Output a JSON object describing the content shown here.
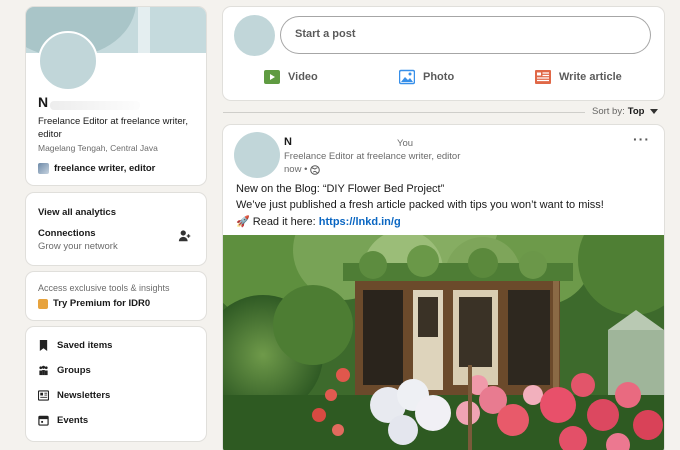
{
  "profile": {
    "name": "N",
    "headline": "Freelance Editor at freelance writer, editor",
    "location": "Magelang Tengah, Central Java",
    "company": "freelance writer, editor"
  },
  "analytics": {
    "view_all": "View all analytics",
    "connections_label": "Connections",
    "connections_sub": "Grow your network"
  },
  "premium": {
    "text": "Access exclusive tools & insights",
    "link": "Try Premium for IDR0"
  },
  "shortcuts": {
    "items": [
      {
        "label": "Saved items",
        "icon": "bookmark-icon"
      },
      {
        "label": "Groups",
        "icon": "groups-icon"
      },
      {
        "label": "Newsletters",
        "icon": "newsletter-icon"
      },
      {
        "label": "Events",
        "icon": "calendar-icon"
      }
    ]
  },
  "composer": {
    "placeholder": "Start a post",
    "video": "Video",
    "photo": "Photo",
    "article": "Write article"
  },
  "sort": {
    "label": "Sort by:",
    "value": "Top"
  },
  "post": {
    "author": "N",
    "you": "You",
    "headline": "Freelance Editor at freelance writer, editor",
    "time": "now •",
    "line1": "New on the Blog: “DIY Flower Bed Project”",
    "line2": "We’ve just published a fresh article packed with tips you won’t want to miss!",
    "line3_prefix": "🚀 Read it here: ",
    "line3_link": "https://lnkd.in/g",
    "image_alt": "garden cottage with flowers"
  },
  "colors": {
    "background": "#f4f2ee",
    "link": "#0a66c2",
    "video": "#5f9b41",
    "photo": "#378fe9",
    "article": "#e06847"
  }
}
